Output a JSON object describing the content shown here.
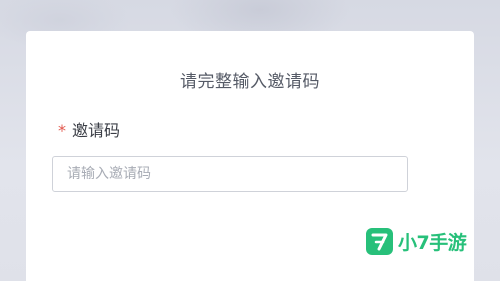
{
  "dialog": {
    "title": "请完整输入邀请码",
    "field": {
      "required_mark": "*",
      "label": "邀请码",
      "value": "",
      "placeholder": "请输入邀请码"
    }
  },
  "watermark": {
    "logo_icon": "seven-logo-icon",
    "text": "小7手游",
    "color": "#27c07a"
  },
  "colors": {
    "required": "#e2574c",
    "input_border": "#cfd2d9",
    "title": "#555a66"
  }
}
